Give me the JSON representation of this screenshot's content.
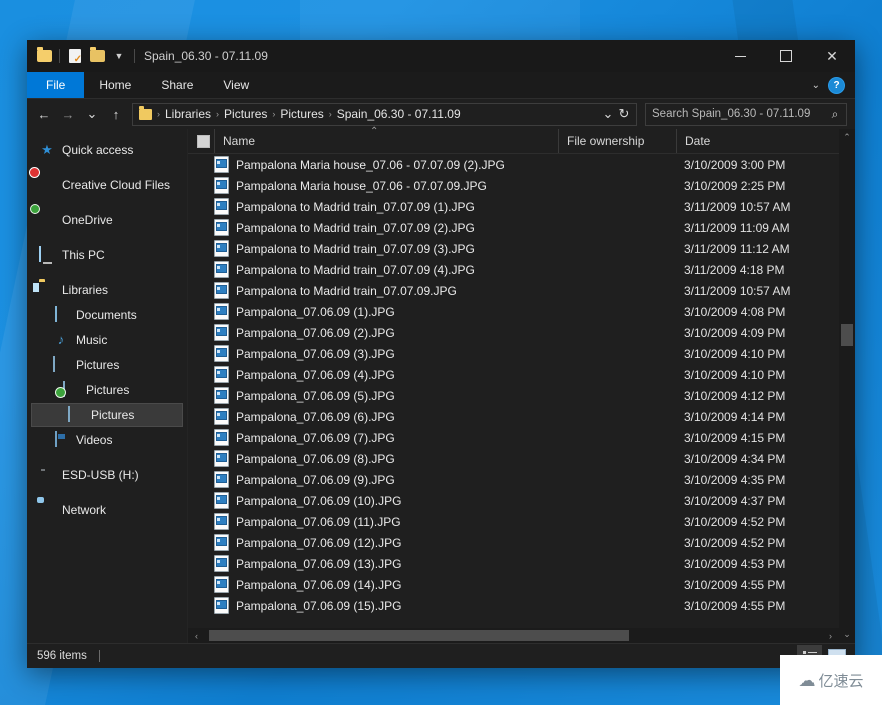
{
  "window": {
    "title": "Spain_06.30 - 07.11.09",
    "controls": {
      "minimize": "—",
      "maximize": "□",
      "close": "✕"
    },
    "quick_access": [
      "folder-icon",
      "save-icon",
      "properties-icon",
      "new-folder-icon",
      "customize-chevron"
    ]
  },
  "ribbon": {
    "tabs": [
      {
        "label": "File",
        "active": true
      },
      {
        "label": "Home",
        "active": false
      },
      {
        "label": "Share",
        "active": false
      },
      {
        "label": "View",
        "active": false
      }
    ],
    "expand_chevron": "⌄",
    "help_label": "?"
  },
  "address": {
    "back": "←",
    "forward": "→",
    "recent_chevron": "⌄",
    "up": "↑",
    "breadcrumbs": [
      "Libraries",
      "Pictures",
      "Pictures",
      "Spain_06.30 - 07.11.09"
    ],
    "dropdown": "⌄",
    "refresh": "↻"
  },
  "search": {
    "placeholder": "Search Spain_06.30 - 07.11.09",
    "value": "",
    "icon": "search-icon"
  },
  "sidebar": {
    "items": [
      {
        "label": "Quick access",
        "icon": "star-icon",
        "indent": 0,
        "selected": false,
        "gap_after": true
      },
      {
        "label": "Creative Cloud Files",
        "icon": "creative-cloud-icon",
        "indent": 0,
        "selected": false,
        "gap_after": true
      },
      {
        "label": "OneDrive",
        "icon": "onedrive-icon",
        "indent": 0,
        "selected": false,
        "gap_after": true
      },
      {
        "label": "This PC",
        "icon": "this-pc-icon",
        "indent": 0,
        "selected": false,
        "gap_after": true
      },
      {
        "label": "Libraries",
        "icon": "libraries-icon",
        "indent": 0,
        "selected": false,
        "gap_after": false
      },
      {
        "label": "Documents",
        "icon": "documents-icon",
        "indent": 1,
        "selected": false,
        "gap_after": false
      },
      {
        "label": "Music",
        "icon": "music-icon",
        "indent": 1,
        "selected": false,
        "gap_after": false
      },
      {
        "label": "Pictures",
        "icon": "pictures-icon",
        "indent": 1,
        "selected": false,
        "gap_after": false
      },
      {
        "label": "Pictures",
        "icon": "pictures-sync-icon",
        "indent": 2,
        "selected": false,
        "gap_after": false
      },
      {
        "label": "Pictures",
        "icon": "pictures-icon",
        "indent": 2,
        "selected": true,
        "gap_after": false
      },
      {
        "label": "Videos",
        "icon": "videos-icon",
        "indent": 1,
        "selected": false,
        "gap_after": true
      },
      {
        "label": "ESD-USB (H:)",
        "icon": "usb-drive-icon",
        "indent": 0,
        "selected": false,
        "gap_after": true
      },
      {
        "label": "Network",
        "icon": "network-icon",
        "indent": 0,
        "selected": false,
        "gap_after": false
      }
    ]
  },
  "columns": {
    "name": "Name",
    "ownership": "File ownership",
    "date": "Date",
    "sort_caret": "⌃"
  },
  "files": [
    {
      "name": "Pampalona Maria house_07.06 - 07.07.09 (2).JPG",
      "ownership": "",
      "date": "3/10/2009 3:00 PM"
    },
    {
      "name": "Pampalona Maria house_07.06 - 07.07.09.JPG",
      "ownership": "",
      "date": "3/10/2009 2:25 PM"
    },
    {
      "name": "Pampalona to Madrid train_07.07.09 (1).JPG",
      "ownership": "",
      "date": "3/11/2009 10:57 AM"
    },
    {
      "name": "Pampalona to Madrid train_07.07.09 (2).JPG",
      "ownership": "",
      "date": "3/11/2009 11:09 AM"
    },
    {
      "name": "Pampalona to Madrid train_07.07.09 (3).JPG",
      "ownership": "",
      "date": "3/11/2009 11:12 AM"
    },
    {
      "name": "Pampalona to Madrid train_07.07.09 (4).JPG",
      "ownership": "",
      "date": "3/11/2009 4:18 PM"
    },
    {
      "name": "Pampalona to Madrid train_07.07.09.JPG",
      "ownership": "",
      "date": "3/11/2009 10:57 AM"
    },
    {
      "name": "Pampalona_07.06.09 (1).JPG",
      "ownership": "",
      "date": "3/10/2009 4:08 PM"
    },
    {
      "name": "Pampalona_07.06.09 (2).JPG",
      "ownership": "",
      "date": "3/10/2009 4:09 PM"
    },
    {
      "name": "Pampalona_07.06.09 (3).JPG",
      "ownership": "",
      "date": "3/10/2009 4:10 PM"
    },
    {
      "name": "Pampalona_07.06.09 (4).JPG",
      "ownership": "",
      "date": "3/10/2009 4:10 PM"
    },
    {
      "name": "Pampalona_07.06.09 (5).JPG",
      "ownership": "",
      "date": "3/10/2009 4:12 PM"
    },
    {
      "name": "Pampalona_07.06.09 (6).JPG",
      "ownership": "",
      "date": "3/10/2009 4:14 PM"
    },
    {
      "name": "Pampalona_07.06.09 (7).JPG",
      "ownership": "",
      "date": "3/10/2009 4:15 PM"
    },
    {
      "name": "Pampalona_07.06.09 (8).JPG",
      "ownership": "",
      "date": "3/10/2009 4:34 PM"
    },
    {
      "name": "Pampalona_07.06.09 (9).JPG",
      "ownership": "",
      "date": "3/10/2009 4:35 PM"
    },
    {
      "name": "Pampalona_07.06.09 (10).JPG",
      "ownership": "",
      "date": "3/10/2009 4:37 PM"
    },
    {
      "name": "Pampalona_07.06.09 (11).JPG",
      "ownership": "",
      "date": "3/10/2009 4:52 PM"
    },
    {
      "name": "Pampalona_07.06.09 (12).JPG",
      "ownership": "",
      "date": "3/10/2009 4:52 PM"
    },
    {
      "name": "Pampalona_07.06.09 (13).JPG",
      "ownership": "",
      "date": "3/10/2009 4:53 PM"
    },
    {
      "name": "Pampalona_07.06.09 (14).JPG",
      "ownership": "",
      "date": "3/10/2009 4:55 PM"
    },
    {
      "name": "Pampalona_07.06.09 (15).JPG",
      "ownership": "",
      "date": "3/10/2009 4:55 PM"
    }
  ],
  "statusbar": {
    "item_count": "596 items",
    "view_details": "details-view-button",
    "view_large_icons": "large-icons-view-button"
  },
  "scrollbars": {
    "up_arrow": "⌃",
    "down_arrow": "⌄",
    "left_arrow": "‹",
    "right_arrow": "›"
  },
  "watermark": {
    "logo": "☁",
    "text": "亿速云"
  },
  "colors": {
    "accent": "#0078d7",
    "window_bg": "#1f1f1f",
    "titlebar_bg": "#191919",
    "desktop": "#1a8fe0"
  }
}
